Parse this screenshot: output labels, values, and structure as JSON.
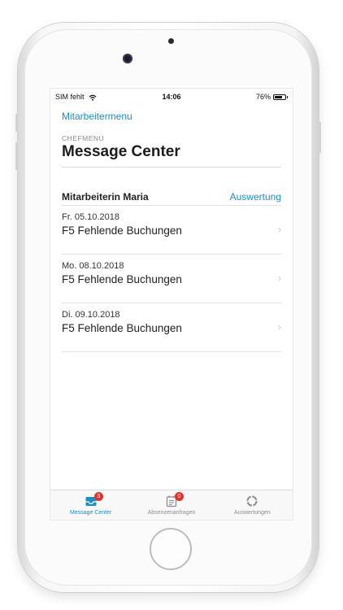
{
  "status_bar": {
    "carrier": "SIM fehlt",
    "time": "14:06",
    "battery": "76%"
  },
  "nav": {
    "back_label": "Mitarbeitermenu"
  },
  "header": {
    "overline": "CHEFMENU",
    "title": "Message Center"
  },
  "section": {
    "name": "Mitarbeiterin Maria",
    "action_label": "Auswertung"
  },
  "messages": [
    {
      "date": "Fr. 05.10.2018",
      "text": "F5 Fehlende Buchungen"
    },
    {
      "date": "Mo. 08.10.2018",
      "text": "F5 Fehlende Buchungen"
    },
    {
      "date": "Di. 09.10.2018",
      "text": "F5 Fehlende Buchungen"
    }
  ],
  "tabbar": {
    "tabs": [
      {
        "label": "Message Center",
        "badge": "3",
        "icon": "inbox-icon",
        "active": true
      },
      {
        "label": "Absenzenanfragen",
        "badge": "0",
        "icon": "calendar-list-icon",
        "active": false
      },
      {
        "label": "Auswertungen",
        "icon": "ring-chart-icon",
        "active": false
      }
    ]
  },
  "colors": {
    "accent": "#1a8fc4",
    "badge": "#e2332b"
  }
}
